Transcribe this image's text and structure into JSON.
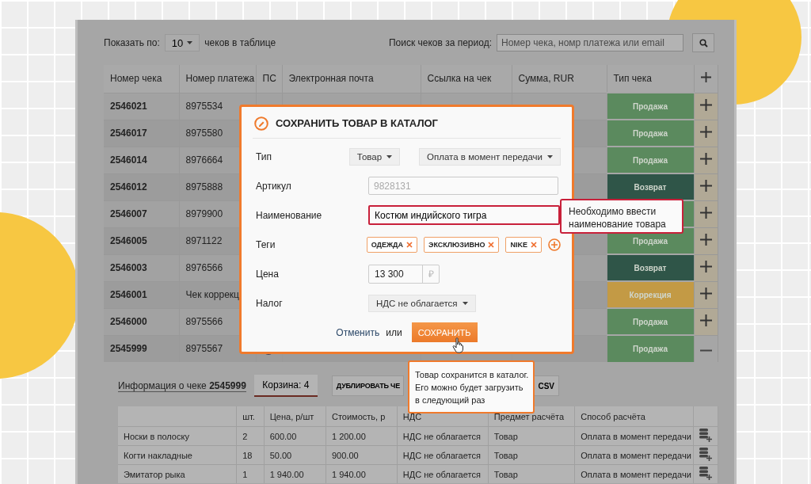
{
  "toolbar": {
    "show_label": "Показать по:",
    "page_size": "10",
    "page_size_suffix": "чеков в таблице",
    "search_label": "Поиск чеков за период:",
    "search_placeholder": "Номер чека, номр платежа или email"
  },
  "table": {
    "columns": [
      "Номер чека",
      "Номер платежа",
      "ПС",
      "Электронная почта",
      "Ссылка на чек",
      "Сумма, RUR",
      "Тип чека"
    ],
    "rows": [
      {
        "receipt": "2546021",
        "payment": "8975534",
        "type": "Продажа",
        "kind": "sale",
        "expanded": false
      },
      {
        "receipt": "2546017",
        "payment": "8975580",
        "type": "Продажа",
        "kind": "sale",
        "expanded": false
      },
      {
        "receipt": "2546014",
        "payment": "8976664",
        "type": "Продажа",
        "kind": "sale",
        "expanded": false
      },
      {
        "receipt": "2546012",
        "payment": "8975888",
        "type": "Возврат",
        "kind": "return",
        "expanded": false
      },
      {
        "receipt": "2546007",
        "payment": "8979900",
        "kind": "sale",
        "expanded": false
      },
      {
        "receipt": "2546005",
        "payment": "8971122",
        "type": "Продажа",
        "kind": "sale",
        "expanded": false
      },
      {
        "receipt": "2546003",
        "payment": "8976566",
        "type": "Возврат",
        "kind": "return",
        "expanded": false
      },
      {
        "receipt": "2546001",
        "payment": "Чек коррекц",
        "type": "Коррекция",
        "kind": "correction",
        "expanded": false
      },
      {
        "receipt": "2546000",
        "payment": "8975566",
        "type": "Продажа",
        "kind": "sale",
        "expanded": false
      },
      {
        "receipt": "2545999",
        "payment": "8975567",
        "type": "Продажа",
        "kind": "sale",
        "expanded": true
      }
    ]
  },
  "modal": {
    "title": "СОХРАНИТЬ ТОВАР В КАТАЛОГ",
    "fields": [
      {
        "kind": "selects",
        "label": "Тип",
        "options": [
          "Товар",
          "Оплата в момент передачи"
        ]
      },
      {
        "kind": "input",
        "label": "Артикул",
        "placeholder": "9828131",
        "error": false
      },
      {
        "kind": "input",
        "label": "Наименование",
        "value": "Костюм индийского тигра",
        "error": true
      },
      {
        "kind": "tags",
        "label": "Теги",
        "tags": [
          "ОДЕЖДА",
          "ЭКСКЛЮЗИВНО",
          "NIKE"
        ]
      },
      {
        "kind": "price",
        "label": "Цена",
        "value": "13 300",
        "currency": "₽"
      },
      {
        "kind": "selects",
        "label": "Налог",
        "options": [
          "НДС не облагается"
        ]
      }
    ],
    "cancel": "Отменить",
    "or": "или",
    "save": "СОХРАНИТЬ"
  },
  "error_tooltip": "Необходимо ввести наименование товара",
  "save_tooltip": "Товар сохранится в каталог. Его можно будет загрузить в следующий раз",
  "details": {
    "info": "Информация о чеке **2545999**",
    "tabs": [
      {
        "label": "Корзина: 4",
        "selected": true
      }
    ],
    "buttons": [
      "ДУБЛИРОВАТЬ ЧЕ",
      "CSV"
    ],
    "items_table": {
      "columns": [
        "шт.",
        "Цена, р/шт",
        "Стоимость, р",
        "НДС",
        "Предмет расчёта",
        "Способ расчёта"
      ],
      "rows": [
        {
          "name": "Носки в полоску",
          "qty": "2",
          "price": "600.00",
          "cost": "1 200.00",
          "vat": "НДС не облагается",
          "subject": "Товар",
          "method": "Оплата в момент передачи"
        },
        {
          "name": "Когти накладные",
          "qty": "18",
          "price": "50.00",
          "cost": "900.00",
          "vat": "НДС не облагается",
          "subject": "Товар",
          "method": "Оплата в момент передачи"
        },
        {
          "name": "Эмитатор рыка",
          "qty": "1",
          "price": "1 940.00",
          "cost": "1 940.00",
          "vat": "НДС не облагается",
          "subject": "Товар",
          "method": "Оплата в момент передачи"
        }
      ]
    }
  }
}
